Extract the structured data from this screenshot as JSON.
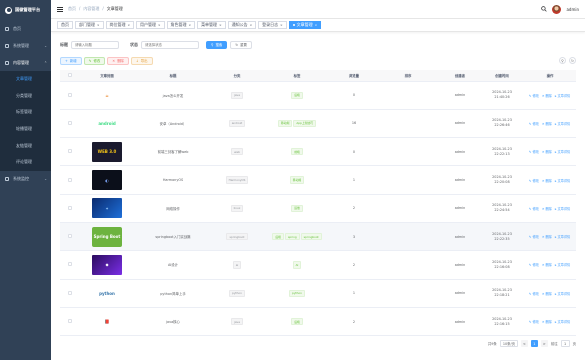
{
  "app": {
    "title": "国徽管理平台"
  },
  "sidebar": {
    "items": [
      {
        "label": "首页",
        "icon": "home-icon"
      },
      {
        "label": "系统管理",
        "icon": "gear-icon"
      },
      {
        "label": "内容管理",
        "icon": "document-icon",
        "open": true
      }
    ],
    "sub_items": [
      {
        "label": "文章管理",
        "active": true
      },
      {
        "label": "分类管理"
      },
      {
        "label": "标签管理"
      },
      {
        "label": "轮播管理"
      },
      {
        "label": "友链管理"
      },
      {
        "label": "评论管理"
      }
    ],
    "after": {
      "label": "系统监控",
      "icon": "monitor-icon"
    }
  },
  "navbar": {
    "breadcrumb": [
      "首页",
      "内容管理",
      "文章管理"
    ],
    "user": "admin"
  },
  "tags": [
    {
      "label": "首页"
    },
    {
      "label": "部门管理"
    },
    {
      "label": "岗位管理"
    },
    {
      "label": "用户管理"
    },
    {
      "label": "角色管理"
    },
    {
      "label": "菜单管理"
    },
    {
      "label": "通知公告"
    },
    {
      "label": "登录日志"
    },
    {
      "label": "文章管理",
      "active": true
    }
  ],
  "search": {
    "field1_label": "标题",
    "field1_placeholder": "请输入标题",
    "field2_label": "状态",
    "field2_placeholder": "请选择状态",
    "search_btn": "搜索",
    "reset_btn": "重置"
  },
  "toolbar": {
    "add": "新增",
    "edit": "修改",
    "delete": "删除",
    "export": "导出"
  },
  "table": {
    "headers": [
      "文章封面",
      "标题",
      "分类",
      "标签",
      "浏览量",
      "排序",
      "创建者",
      "创建时间",
      "操作"
    ],
    "rows": [
      {
        "cover": "java",
        "title": "java怎么开发",
        "category": "java",
        "tags": [
          "后端"
        ],
        "views": "0",
        "creator": "admin",
        "date": "2024-10-23",
        "time": "21:40:26"
      },
      {
        "cover": "android",
        "title": "安卓（Android）",
        "category": "android",
        "tags": [
          "移动端",
          "App上架技巧"
        ],
        "views": "16",
        "creator": "admin",
        "date": "2024-10-23",
        "time": "22:26:46"
      },
      {
        "cover": "web",
        "title": "前端三剑客了解web",
        "category": "web",
        "tags": [
          "前端"
        ],
        "views": "0",
        "creator": "admin",
        "date": "2024-10-23",
        "time": "22:22:13"
      },
      {
        "cover": "harmony",
        "title": "HarmonyOS",
        "category": "HarmonyOS",
        "tags": [
          "移动端"
        ],
        "views": "1",
        "creator": "admin",
        "date": "2024-10-23",
        "time": "22:20:08"
      },
      {
        "cover": "network",
        "title": "网络操作",
        "category": "linux",
        "tags": [
          "运维"
        ],
        "views": "2",
        "creator": "admin",
        "date": "2024-10-23",
        "time": "22:24:54"
      },
      {
        "cover": "spring",
        "title": "springboot入门实战篇",
        "category": "springboot",
        "tags": [
          "后端",
          "spring",
          "springboot"
        ],
        "views": "3",
        "creator": "admin",
        "date": "2024-10-23",
        "time": "22:22:35",
        "highlight": true
      },
      {
        "cover": "ai",
        "title": "AI设计",
        "category": "ai",
        "tags": [
          "AI"
        ],
        "views": "2",
        "creator": "admin",
        "date": "2024-10-23",
        "time": "22:16:08"
      },
      {
        "cover": "python",
        "title": "python简单上手",
        "category": "python",
        "tags": [
          "python"
        ],
        "views": "1",
        "creator": "admin",
        "date": "2024-10-23",
        "time": "22:18:21"
      },
      {
        "cover": "javabook",
        "title": "java核心",
        "category": "java",
        "tags": [
          "后端"
        ],
        "views": "2",
        "creator": "admin",
        "date": "2024-10-23",
        "time": "22:16:15"
      }
    ],
    "ops": [
      "修改",
      "删除",
      "文章详情"
    ]
  },
  "pagination": {
    "total": "共9条",
    "size": "10条/页",
    "prev": "<",
    "page": "1",
    "next": ">",
    "goto": "前往",
    "goto_val": "1",
    "page_suffix": "页"
  },
  "cover_text": {
    "android": "android",
    "web": "WEB 3.0",
    "spring": "Spring Boot",
    "python": "python"
  },
  "colors": {
    "accent": "#409eff",
    "sidebar": "#304156"
  }
}
